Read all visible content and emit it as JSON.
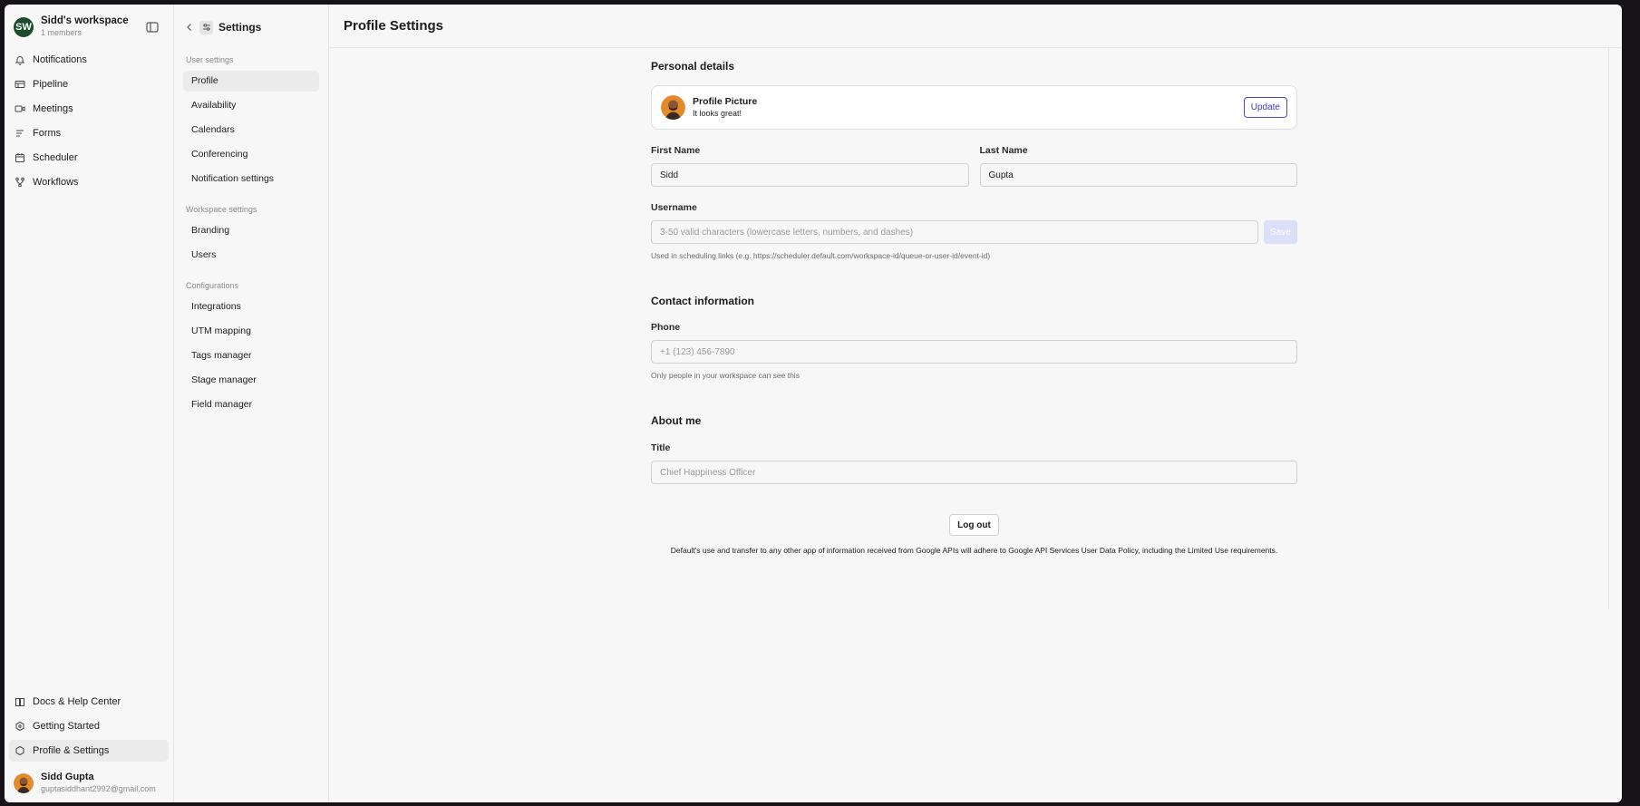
{
  "workspace": {
    "initials": "SW",
    "name": "Sidd's workspace",
    "members": "1 members"
  },
  "nav": {
    "items": [
      {
        "label": "Notifications",
        "icon": "bell-icon"
      },
      {
        "label": "Pipeline",
        "icon": "pipeline-icon"
      },
      {
        "label": "Meetings",
        "icon": "meetings-icon"
      },
      {
        "label": "Forms",
        "icon": "forms-icon"
      },
      {
        "label": "Scheduler",
        "icon": "calendar-icon"
      },
      {
        "label": "Workflows",
        "icon": "workflow-icon"
      }
    ],
    "bottom": [
      {
        "label": "Docs & Help Center",
        "icon": "book-icon"
      },
      {
        "label": "Getting Started",
        "icon": "rocket-icon"
      },
      {
        "label": "Profile & Settings",
        "icon": "hexagon-icon"
      }
    ]
  },
  "user": {
    "name": "Sidd Gupta",
    "email": "guptasiddhant2992@gmail.com"
  },
  "settings": {
    "title": "Settings",
    "groups": [
      {
        "label": "User settings",
        "items": [
          "Profile",
          "Availability",
          "Calendars",
          "Conferencing",
          "Notification settings"
        ]
      },
      {
        "label": "Workspace settings",
        "items": [
          "Branding",
          "Users"
        ]
      },
      {
        "label": "Configurations",
        "items": [
          "Integrations",
          "UTM mapping",
          "Tags manager",
          "Stage manager",
          "Field manager"
        ]
      }
    ]
  },
  "main": {
    "title": "Profile Settings",
    "personal": {
      "title": "Personal details",
      "picture_title": "Profile Picture",
      "picture_sub": "It looks great!",
      "update_label": "Update",
      "first_name_label": "First Name",
      "first_name_value": "Sidd",
      "last_name_label": "Last Name",
      "last_name_value": "Gupta",
      "username_label": "Username",
      "username_placeholder": "3-50 valid characters (lowercase letters, numbers, and dashes)",
      "save_label": "Save",
      "username_help": "Used in scheduling links (e.g. https://scheduler.default.com/workspace-id/queue-or-user-id/event-id)"
    },
    "contact": {
      "title": "Contact information",
      "phone_label": "Phone",
      "phone_placeholder": "+1 (123) 456-7890",
      "phone_help": "Only people in your workspace can see this"
    },
    "about": {
      "title": "About me",
      "title_label": "Title",
      "title_placeholder": "Chief Happiness Officer"
    },
    "logout_label": "Log out",
    "policy": "Default's use and transfer to any other app of information received from Google APIs will adhere to Google API Services User Data Policy, including the Limited Use requirements."
  }
}
